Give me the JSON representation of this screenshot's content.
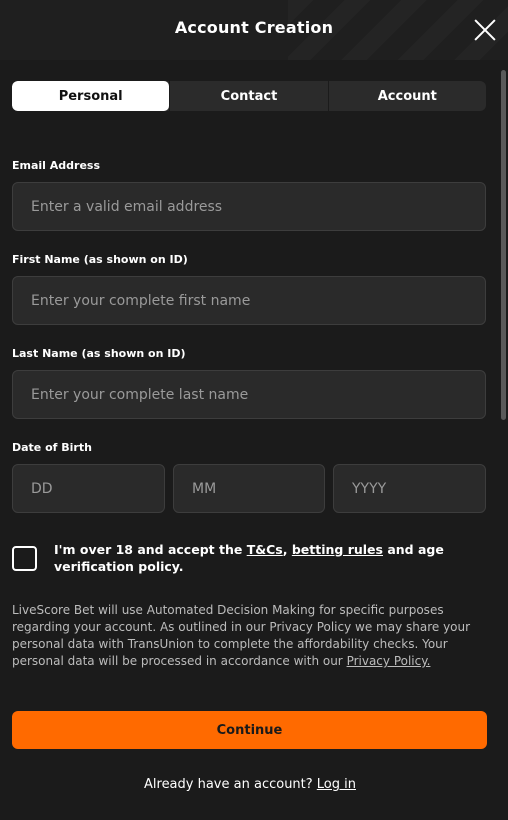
{
  "header": {
    "title": "Account Creation",
    "close_icon": "close-icon"
  },
  "tabs": [
    {
      "label": "Personal",
      "active": true
    },
    {
      "label": "Contact",
      "active": false
    },
    {
      "label": "Account",
      "active": false
    }
  ],
  "form": {
    "email": {
      "label": "Email Address",
      "placeholder": "Enter a valid email address",
      "value": ""
    },
    "first_name": {
      "label": "First Name (as shown on ID)",
      "placeholder": "Enter your complete first name",
      "value": ""
    },
    "last_name": {
      "label": "Last Name (as shown on ID)",
      "placeholder": "Enter your complete last name",
      "value": ""
    },
    "dob": {
      "label": "Date of Birth",
      "day_placeholder": "DD",
      "month_placeholder": "MM",
      "year_placeholder": "YYYY"
    }
  },
  "consent": {
    "checked": false,
    "text_part1": "I'm over 18 and accept the ",
    "tcs_link": "T&Cs",
    "separator": ", ",
    "betting_rules_link": "betting rules",
    "text_part2": " and age verification policy."
  },
  "notice": {
    "text": "LiveScore Bet will use Automated Decision Making for specific purposes regarding your account. As outlined in our Privacy Policy we may share your personal data with TransUnion to complete the affordability checks. Your personal data will be processed in accordance with our ",
    "privacy_link": "Privacy Policy."
  },
  "actions": {
    "continue_label": "Continue",
    "login_prompt": "Already have an account? ",
    "login_link": "Log in"
  },
  "colors": {
    "accent": "#ff6a00",
    "background": "#1b1b1b",
    "field_background": "#2a2a2a"
  }
}
